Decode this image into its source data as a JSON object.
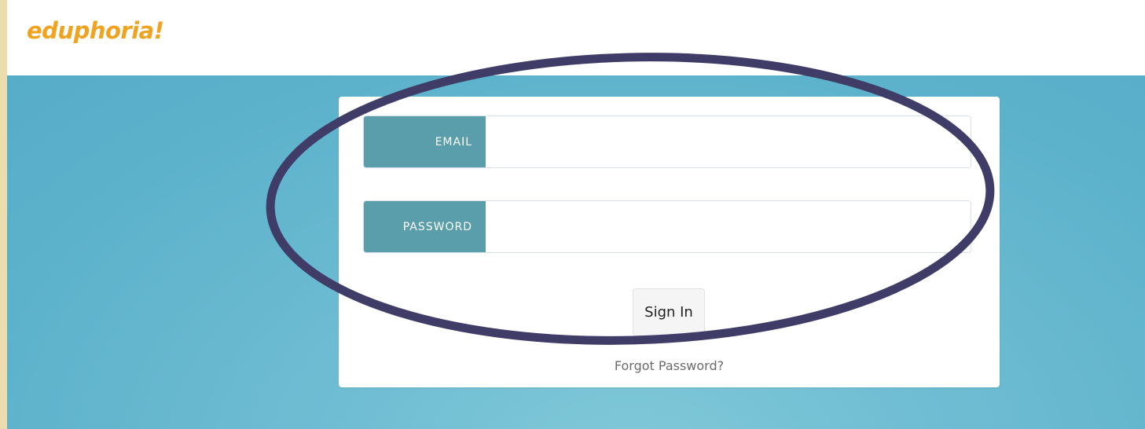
{
  "header": {
    "logo_text": "eduphoria!",
    "logo_color": "#f0a320"
  },
  "login": {
    "email_label": "EMAIL",
    "email_value": "",
    "email_placeholder": "",
    "password_label": "PASSWORD",
    "password_value": "",
    "password_placeholder": "",
    "signin_label": "Sign In",
    "forgot_label": "Forgot Password?"
  },
  "colors": {
    "outer_border": "#ecdcae",
    "background": "#64b3cb",
    "field_label_bg": "#5a9eab",
    "annotation_stroke": "#3f3d68"
  },
  "annotation": {
    "shape": "ellipse",
    "description_icon": "highlight-ellipse-icon"
  }
}
